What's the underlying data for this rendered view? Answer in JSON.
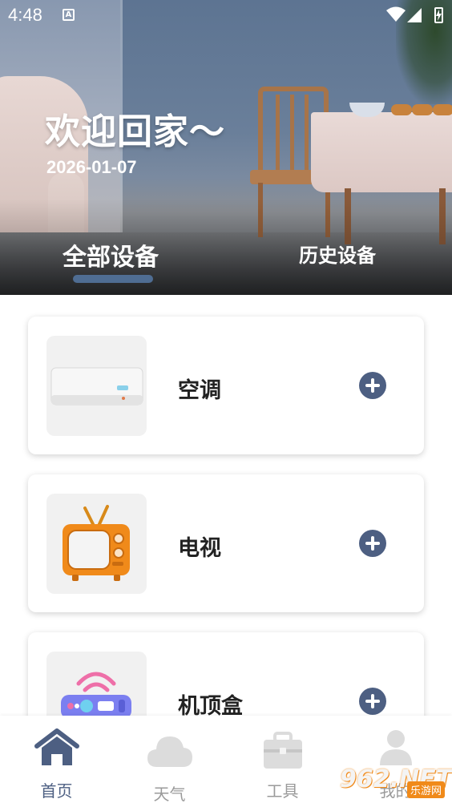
{
  "status_bar": {
    "time": "4:48",
    "notification_icon": "a-icon"
  },
  "header": {
    "welcome": "欢迎回家～",
    "date": "2026-01-07",
    "tabs": [
      {
        "label": "全部设备",
        "active": true
      },
      {
        "label": "历史设备",
        "active": false
      }
    ]
  },
  "devices": [
    {
      "name": "空调",
      "icon": "air-conditioner-icon"
    },
    {
      "name": "电视",
      "icon": "television-icon"
    },
    {
      "name": "机顶盒",
      "icon": "set-top-box-icon"
    }
  ],
  "bottom_nav": [
    {
      "label": "首页",
      "icon": "home-icon",
      "active": true
    },
    {
      "label": "天气",
      "icon": "cloud-icon",
      "active": false
    },
    {
      "label": "工具",
      "icon": "toolbox-icon",
      "active": false
    },
    {
      "label": "我的",
      "icon": "user-icon",
      "active": false
    }
  ],
  "watermark": {
    "logo": "962.NET",
    "sub": "乐游网"
  },
  "colors": {
    "accent": "#4d5f82",
    "inactive": "#9a9a9a",
    "indicator": "#4f6d93"
  }
}
